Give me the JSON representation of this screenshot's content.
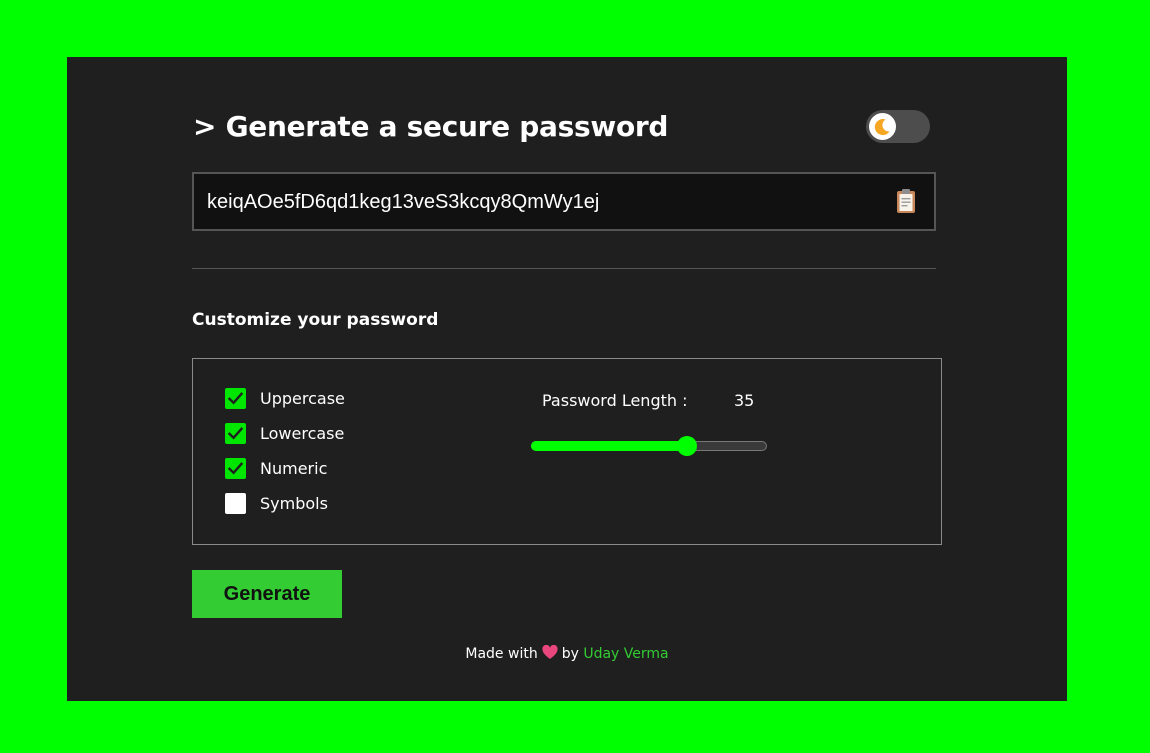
{
  "header": {
    "title": "> Generate a secure password",
    "theme_toggle_icon": "moon-icon"
  },
  "password": {
    "value": "keiqAOe5fD6qd1keg13veS3kcqy8QmWy1ej",
    "copy_icon": "clipboard-icon"
  },
  "customize": {
    "title": "Customize your password",
    "options": [
      {
        "label": "Uppercase",
        "checked": true
      },
      {
        "label": "Lowercase",
        "checked": true
      },
      {
        "label": "Numeric",
        "checked": true
      },
      {
        "label": "Symbols",
        "checked": false
      }
    ],
    "length_label": "Password Length :",
    "length_value": "35",
    "slider_fraction": 0.66
  },
  "actions": {
    "generate_label": "Generate"
  },
  "footer": {
    "made_with": "Made with",
    "heart_icon": "heart-icon",
    "by": "by",
    "author": "Uday Verma"
  },
  "colors": {
    "page_background": "#00ff00",
    "card_background": "#1f1f1f",
    "accent": "#00ff00",
    "button": "#33cc33",
    "author_link": "#33cc33"
  }
}
